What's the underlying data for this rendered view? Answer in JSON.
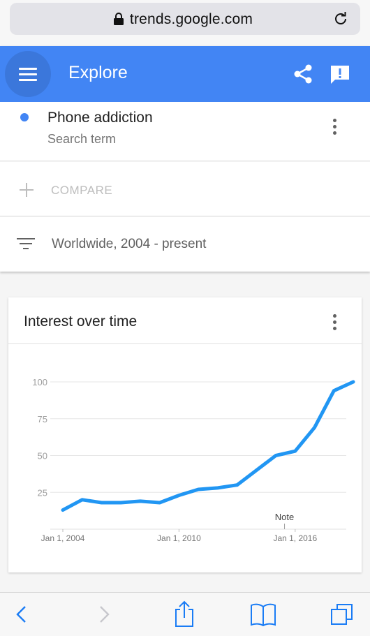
{
  "browser": {
    "url": "trends.google.com"
  },
  "appbar": {
    "title": "Explore",
    "color": "#4285f4"
  },
  "search_term": {
    "name": "Phone addiction",
    "type": "Search term",
    "color": "#4285f4"
  },
  "compare": {
    "label": "COMPARE"
  },
  "filter": {
    "label": "Worldwide, 2004 - present"
  },
  "chart_card": {
    "title": "Interest over time",
    "note_label": "Note"
  },
  "chart_data": {
    "type": "line",
    "x": [
      "2004",
      "2005",
      "2006",
      "2007",
      "2008",
      "2009",
      "2010",
      "2011",
      "2012",
      "2013",
      "2014",
      "2015",
      "2016",
      "2017",
      "2018",
      "2019"
    ],
    "x_tick_labels": [
      "Jan 1, 2004",
      "Jan 1, 2010",
      "Jan 1, 2016"
    ],
    "x_tick_years": [
      2004,
      2010,
      2016
    ],
    "y_ticks": [
      25,
      50,
      75,
      100
    ],
    "ylim": [
      0,
      100
    ],
    "grid": true,
    "series": [
      {
        "color": "#2196f3",
        "points": [
          [
            2004.0,
            13
          ],
          [
            2005.0,
            20
          ],
          [
            2006.0,
            18
          ],
          [
            2007.0,
            18
          ],
          [
            2008.0,
            19
          ],
          [
            2009.0,
            18
          ],
          [
            2010.0,
            23
          ],
          [
            2011.0,
            27
          ],
          [
            2012.0,
            28
          ],
          [
            2013.0,
            30
          ],
          [
            2014.0,
            40
          ],
          [
            2015.0,
            50
          ],
          [
            2016.0,
            53
          ],
          [
            2017.0,
            69
          ],
          [
            2018.0,
            94
          ],
          [
            2019.0,
            100
          ]
        ]
      }
    ]
  },
  "icons": {
    "lock": "lock-icon",
    "reload": "reload-icon",
    "menu": "menu-icon",
    "share": "share-icon",
    "feedback": "feedback-icon",
    "more": "more-vert-icon",
    "add": "add-icon",
    "filter": "filter-icon",
    "back": "back-icon",
    "forward": "forward-icon",
    "browser_share": "share-upload-icon",
    "bookmarks": "book-icon",
    "tabs": "tabs-icon"
  }
}
